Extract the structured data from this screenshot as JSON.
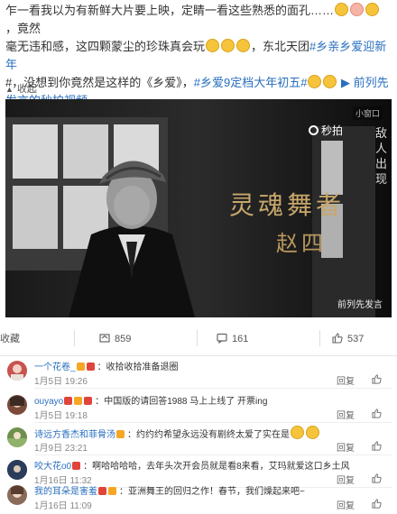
{
  "post": {
    "line1": "乍一看我以为有新鲜大片要上映，定睛一看这些熟悉的面孔……",
    "line1_end": "，竟然",
    "line2": "毫无违和感，这四颗蒙尘的珍珠真会玩",
    "line2_end": "，东北天团",
    "tag1": "#乡亲乡爱迎新年",
    "line3_start": "#，没想到你竟然是这样的《乡爱》，",
    "tag2": "#乡爱9定档大年初五#",
    "link": "前列先发言的秒拍视频"
  },
  "collapse_label": "收起",
  "video": {
    "mini_label": "小窗口",
    "brand": "秒拍",
    "caption_line1": "灵魂舞者",
    "caption_line2": "赵四",
    "credit": "前列先发言",
    "side_text": "敌人出现"
  },
  "actions": {
    "repost_label": "收藏",
    "repost_count": "859",
    "comment_count": "161",
    "like_count": "537"
  },
  "comments": [
    {
      "user": "一个花卷_",
      "text": "：收拾收拾准备退圈",
      "time": "1月5日 19:26",
      "reply": "回复",
      "avatar_color": "#c9534f"
    },
    {
      "user": "ouyayo",
      "text": "：中国版的请回答1988 马上上线了 开票ing",
      "time": "1月5日 19:18",
      "reply": "回复",
      "avatar_color": "#7a4b3a"
    },
    {
      "user": "诗远方香杰和菲骨汤",
      "text": "：约约约希望永远没有剧终太爱了实在是",
      "time": "1月9日 23:21",
      "reply": "回复",
      "avatar_color": "#6f8f4e"
    },
    {
      "user": "咬大花o0",
      "text": "：啊哈哈哈哈，去年头次开会员就是看8来看，艾玛就爱这口乡土风",
      "time": "1月16日 11:32",
      "reply": "回复",
      "avatar_color": "#3a4a6a"
    },
    {
      "user": "我的耳朵是害羞",
      "text": "：亚洲舞王的回归之作！春节，我们燥起来吧~",
      "time": "1月16日 11:09",
      "reply": "回复",
      "avatar_color": "#8a6b5a"
    }
  ],
  "colors": {
    "link": "#2a6fbf",
    "caption": "#c8a76a",
    "emoji": "#f6c43a"
  },
  "icons": [
    "chevron-up-icon",
    "repost-icon",
    "comment-icon",
    "like-icon",
    "miaopai-logo-icon"
  ]
}
